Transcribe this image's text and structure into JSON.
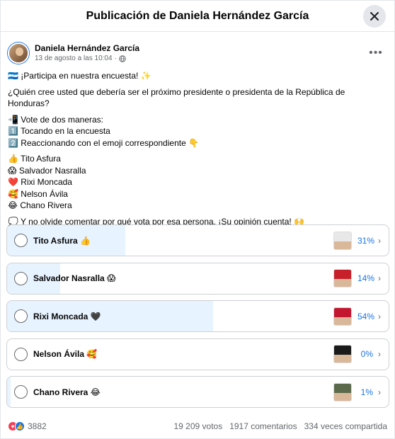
{
  "header": {
    "title": "Publicación de Daniela Hernández García"
  },
  "post": {
    "author": "Daniela Hernández García",
    "date": "13 de agosto a las 10:04",
    "lines": {
      "intro": "🇭🇳 ¡Participa en nuestra encuesta! ✨",
      "question": "¿Quién cree usted que debería ser el próximo presidente o presidenta de la República de Honduras?",
      "vote_header": "📲 Vote de dos maneras:",
      "vote_1": "1️⃣ Tocando en la encuesta",
      "vote_2": "2️⃣ Reaccionando con el emoji correspondiente 👇",
      "cand_1": "👍 Tito Asfura",
      "cand_2": "😱 Salvador Nasralla",
      "cand_3": "❤️ Rixi Moncada",
      "cand_4": "🥰 Nelson Ávila",
      "cand_5": "😂 Chano Rivera",
      "closing": "💭 Y no olvide comentar por qué vota por esa persona. ¡Su opinión cuenta! 🙌"
    }
  },
  "poll": {
    "options": [
      {
        "label": "Tito Asfura 👍",
        "percent": "31%",
        "fill": 0.31,
        "thumb": "#e8e8e8"
      },
      {
        "label": "Salvador Nasralla 😱",
        "percent": "14%",
        "fill": 0.14,
        "thumb": "#c8202a"
      },
      {
        "label": "Rixi Moncada 🖤",
        "percent": "54%",
        "fill": 0.54,
        "thumb": "#c3162f"
      },
      {
        "label": "Nelson Ávila 🥰",
        "percent": "0%",
        "fill": 0.0,
        "thumb": "#1a1a1a"
      },
      {
        "label": "Chano Rivera 😂",
        "percent": "1%",
        "fill": 0.01,
        "thumb": "#5a6a4a"
      }
    ]
  },
  "footer": {
    "reaction_count": "3882",
    "votes": "19 209 votos",
    "comments": "1917 comentarios",
    "shares": "334 veces compartida"
  },
  "colors": {
    "accent": "#1b74e4",
    "fill": "#e7f3ff",
    "love": "#f33e58",
    "like": "#1b74e4"
  }
}
